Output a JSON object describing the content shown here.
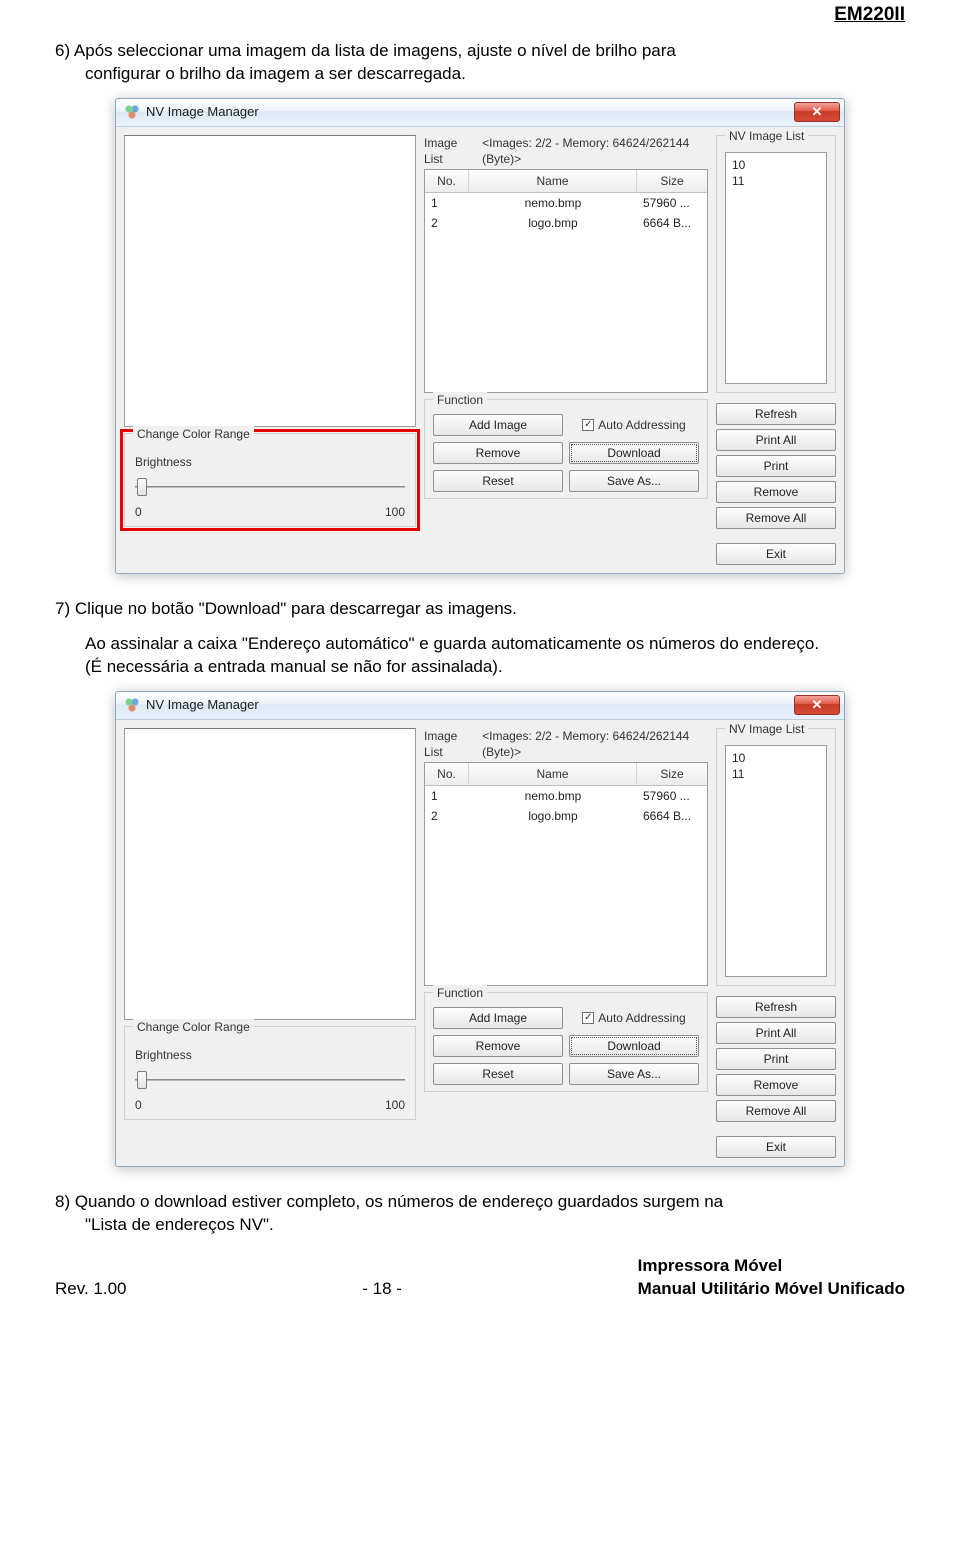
{
  "product_header": "EM220II",
  "para6_main": "6) Após seleccionar uma imagem da lista de imagens, ajuste o nível de brilho para",
  "para6_sub": "configurar o brilho da imagem a ser descarregada.",
  "para7": "7) Clique no botão \"Download\" para descarregar as imagens.",
  "para7b_main": "Ao assinalar a caixa \"Endereço automático\" e guarda automaticamente os números do endereço.",
  "para7c": "(É necessária a entrada manual se não for assinalada).",
  "para8_main": "8) Quando o download estiver completo, os números de endereço guardados surgem na",
  "para8_sub": "\"Lista de endereços NV\".",
  "dialog": {
    "title": "NV Image Manager",
    "close_x": "✕",
    "image_list_label": "Image List",
    "image_list_info": "<Images: 2/2 - Memory: 64624/262144 (Byte)>",
    "headers": {
      "no": "No.",
      "name": "Name",
      "size": "Size"
    },
    "rows": [
      {
        "no": "1",
        "name": "nemo.bmp",
        "size": "57960 ..."
      },
      {
        "no": "2",
        "name": "logo.bmp",
        "size": "6664 B..."
      }
    ],
    "nv_list_label": "NV Image List",
    "nv_items": [
      "10",
      "11"
    ],
    "nv_buttons": {
      "refresh": "Refresh",
      "print_all": "Print All",
      "print": "Print",
      "remove": "Remove",
      "remove_all": "Remove All"
    },
    "color_range_label": "Change Color Range",
    "brightness_label": "Brightness",
    "brightness_min": "0",
    "brightness_max": "100",
    "function_label": "Function",
    "function_buttons": {
      "add_image": "Add Image",
      "auto_addr": "Auto Addressing",
      "remove": "Remove",
      "download": "Download",
      "reset": "Reset",
      "save_as": "Save As..."
    },
    "checkbox_mark": "✓",
    "exit": "Exit"
  },
  "footer": {
    "rev": "Rev. 1.00",
    "page": "- 18 -",
    "r1": "Impressora Móvel",
    "r2": "Manual Utilitário Móvel Unificado"
  }
}
